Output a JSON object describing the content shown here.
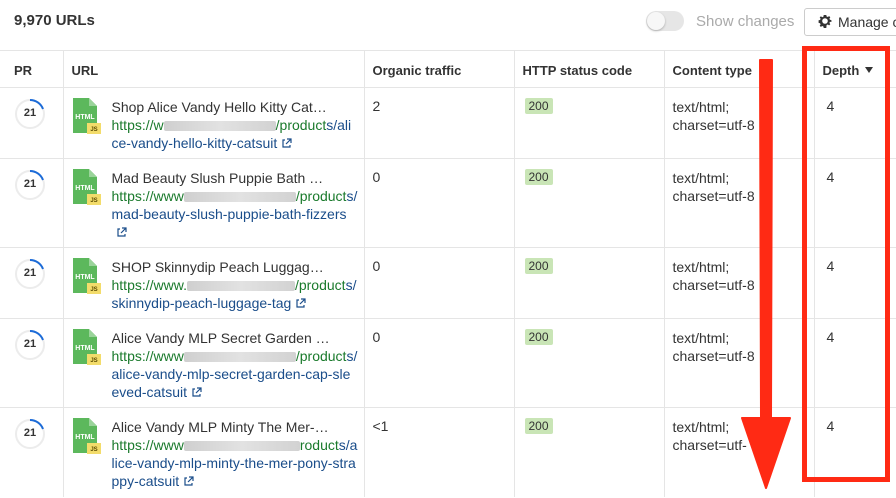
{
  "toolbar": {
    "url_count": "9,970 URLs",
    "show_changes_label": "Show changes",
    "show_changes_on": false,
    "manage_label": "Manage c"
  },
  "table": {
    "columns": [
      "PR",
      "URL",
      "Organic traffic",
      "HTTP status code",
      "Content type",
      "Depth"
    ],
    "sorted_by": "Depth",
    "rows": [
      {
        "pr": "21",
        "file_type_top": "HTML",
        "file_type_badge": "JS",
        "title": "Shop Alice Vandy Hello Kitty Cat…",
        "url_prefix": "https://w",
        "url_mid": "/product",
        "url_path": "s/alice-vandy-hello-kitty-catsuit",
        "organic_traffic": "2",
        "status_code": "200",
        "content_type_1": "text/html;",
        "content_type_2": "charset=utf-8",
        "depth": "4"
      },
      {
        "pr": "21",
        "file_type_top": "HTML",
        "file_type_badge": "JS",
        "title": "Mad Beauty Slush Puppie Bath …",
        "url_prefix": "https://www",
        "url_mid": "/product",
        "url_path": "s/mad-beauty-slush-puppie-bath-fizzers",
        "organic_traffic": "0",
        "status_code": "200",
        "content_type_1": "text/html;",
        "content_type_2": "charset=utf-8",
        "depth": "4"
      },
      {
        "pr": "21",
        "file_type_top": "HTML",
        "file_type_badge": "JS",
        "title": "SHOP Skinnydip Peach Luggag…",
        "url_prefix": "https://www.",
        "url_mid": "/product",
        "url_path": "s/skinnydip-peach-luggage-tag",
        "organic_traffic": "0",
        "status_code": "200",
        "content_type_1": "text/html;",
        "content_type_2": "charset=utf-8",
        "depth": "4"
      },
      {
        "pr": "21",
        "file_type_top": "HTML",
        "file_type_badge": "JS",
        "title": "Alice Vandy MLP Secret Garden …",
        "url_prefix": "https://www",
        "url_mid": "/product",
        "url_path": "s/alice-vandy-mlp-secret-garden-cap-sleeved-catsuit",
        "organic_traffic": "0",
        "status_code": "200",
        "content_type_1": "text/html;",
        "content_type_2": "charset=utf-8",
        "depth": "4"
      },
      {
        "pr": "21",
        "file_type_top": "HTML",
        "file_type_badge": "JS",
        "title": "Alice Vandy MLP Minty The Mer-…",
        "url_prefix": "https://www",
        "url_mid": "roduct",
        "url_path": "s/alice-vandy-mlp-minty-the-mer-pony-strappy-catsuit",
        "organic_traffic": "<1",
        "status_code": "200",
        "content_type_1": "text/html;",
        "content_type_2": "charset=utf-",
        "depth": "4"
      }
    ]
  },
  "colors": {
    "highlight": "#ff2a14",
    "link_green": "#1a7a2c",
    "link_blue": "#1a4d8a",
    "badge_green": "#c9e5b6",
    "file_icon_green": "#5cb85c",
    "js_badge_yellow": "#f3dc6b"
  }
}
